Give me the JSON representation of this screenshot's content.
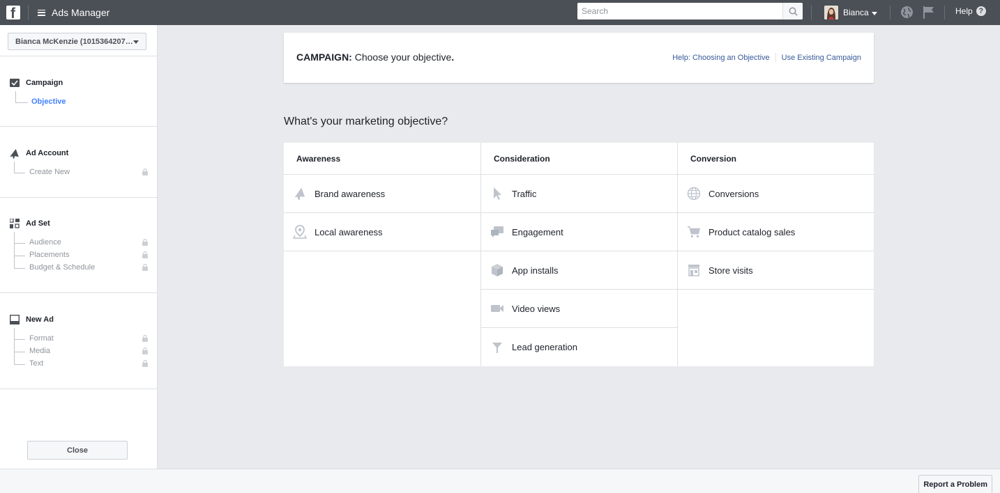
{
  "topbar": {
    "logo_letter": "f",
    "app_title": "Ads Manager",
    "search_placeholder": "Search",
    "user_name": "Bianca",
    "help_label": "Help",
    "help_symbol": "?"
  },
  "sidebar": {
    "account_selector": "Bianca McKenzie (1015364207…",
    "sections": [
      {
        "title": "Campaign",
        "icon": "checkbox-icon",
        "children": [
          {
            "label": "Objective",
            "active": true,
            "locked": false
          }
        ]
      },
      {
        "title": "Ad Account",
        "icon": "megaphone-icon",
        "children": [
          {
            "label": "Create New",
            "locked": true
          }
        ]
      },
      {
        "title": "Ad Set",
        "icon": "grid-icon",
        "children": [
          {
            "label": "Audience",
            "locked": true
          },
          {
            "label": "Placements",
            "locked": true
          },
          {
            "label": "Budget & Schedule",
            "locked": true
          }
        ]
      },
      {
        "title": "New Ad",
        "icon": "ad-preview-icon",
        "children": [
          {
            "label": "Format",
            "locked": true
          },
          {
            "label": "Media",
            "locked": true
          },
          {
            "label": "Text",
            "locked": true
          }
        ]
      }
    ],
    "close_label": "Close"
  },
  "campaign": {
    "title_prefix": "CAMPAIGN:",
    "title_text": " Choose your objective",
    "title_suffix": ".",
    "help_link": "Help: Choosing an Objective",
    "existing_link": "Use Existing Campaign"
  },
  "question": "What's your marketing objective?",
  "objectives": {
    "awareness": {
      "header": "Awareness",
      "items": [
        {
          "label": "Brand awareness",
          "icon": "megaphone-icon"
        },
        {
          "label": "Local awareness",
          "icon": "location-pin-icon"
        }
      ]
    },
    "consideration": {
      "header": "Consideration",
      "items": [
        {
          "label": "Traffic",
          "icon": "cursor-icon"
        },
        {
          "label": "Engagement",
          "icon": "chat-bubbles-icon"
        },
        {
          "label": "App installs",
          "icon": "cube-icon"
        },
        {
          "label": "Video views",
          "icon": "video-camera-icon"
        },
        {
          "label": "Lead generation",
          "icon": "funnel-icon"
        }
      ]
    },
    "conversion": {
      "header": "Conversion",
      "items": [
        {
          "label": "Conversions",
          "icon": "globe-icon"
        },
        {
          "label": "Product catalog sales",
          "icon": "shopping-cart-icon"
        },
        {
          "label": "Store visits",
          "icon": "store-icon"
        }
      ]
    }
  },
  "footer": {
    "report_label": "Report a Problem"
  },
  "colors": {
    "topbar": "#4b4f56",
    "link": "#365899",
    "active": "#4080ff",
    "icon_gray": "#bec3cc"
  }
}
